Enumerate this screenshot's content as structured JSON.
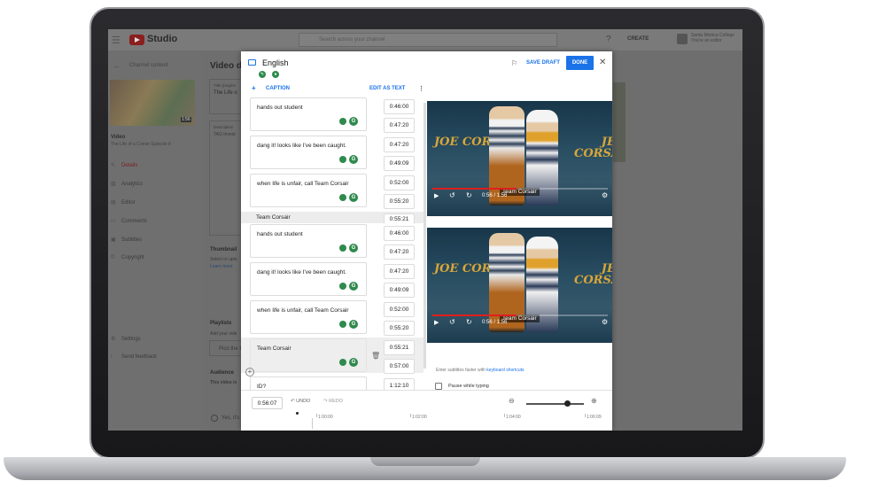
{
  "studio": {
    "brand": "Studio",
    "search_placeholder": "Search across your channel",
    "create_label": "CREATE",
    "account_name": "Santa Monica College",
    "account_sub": "You're an editor",
    "side": {
      "back_label": "Channel content",
      "video_label": "Video",
      "video_title": "The Life of a Comer Episode 8",
      "duration": "1:56",
      "nav": [
        {
          "label": "Details",
          "icon": "pencil-icon",
          "active": true
        },
        {
          "label": "Analytics",
          "icon": "chart-icon",
          "active": false
        },
        {
          "label": "Editor",
          "icon": "film-icon",
          "active": false
        },
        {
          "label": "Comments",
          "icon": "comment-icon",
          "active": false
        },
        {
          "label": "Subtitles",
          "icon": "subtitles-icon",
          "active": false
        },
        {
          "label": "Copyright",
          "icon": "copyright-icon",
          "active": false
        }
      ],
      "bottom_nav": [
        {
          "label": "Settings",
          "icon": "gear-icon"
        },
        {
          "label": "Send feedback",
          "icon": "feedback-icon"
        }
      ]
    },
    "main": {
      "heading": "Video d",
      "title_label": "Title (require",
      "title_value": "The Life o",
      "desc_label": "Description",
      "desc_value": "TAG Invest",
      "thumbnail": "Thumbnail",
      "thumb_sub": "Select or uplo",
      "learn_more": "Learn more",
      "playlists": "Playlists",
      "playlists_sub": "Add your vide",
      "playlist_value": "Pico the P",
      "audience": "Audience",
      "audience_sub": "This video is",
      "yes_label": "Yes, it's"
    }
  },
  "modal": {
    "language": "English",
    "save_draft": "SAVE DRAFT",
    "done": "DONE",
    "caption_button": "CAPTION",
    "edit_as_text": "EDIT AS TEXT",
    "captions": [
      {
        "text": "hands out student",
        "start": "0:46:00",
        "end": "0:47:20",
        "style": "box"
      },
      {
        "text": "dang it! looks like I've been caught.",
        "start": "0:47:20",
        "end": "0:49:09",
        "style": "box"
      },
      {
        "text": "when life is unfair, call Team Corsair",
        "start": "0:52:00",
        "end": "0:55:20",
        "style": "box"
      },
      {
        "text": "Team Corsair",
        "start": "0:55:21",
        "end": "",
        "style": "plain"
      },
      {
        "text": "hands out student",
        "start": "0:46:00",
        "end": "0:47:20",
        "style": "box"
      },
      {
        "text": "dang it! looks like I've been caught.",
        "start": "0:47:20",
        "end": "0:49:09",
        "style": "box"
      },
      {
        "text": "when life is unfair, call Team Corsair",
        "start": "0:52:00",
        "end": "0:55:20",
        "style": "box"
      },
      {
        "text": "Team Corsair",
        "start": "0:55:21",
        "end": "0:57:00",
        "style": "selected"
      },
      {
        "text": "ID?",
        "start": "1:12:10",
        "end": "",
        "style": "box"
      }
    ],
    "preview": {
      "left_title": "JOE CORSAIR",
      "right_title": "JEAN CORSAIR",
      "subtitle": "Team Corsair",
      "time": "0:56 / 1:56",
      "progress": 0.48,
      "hint_prefix": "Enter subtitles faster with ",
      "hint_link": "keyboard shortcuts"
    },
    "pause_label": "Pause while typing",
    "timecode": "0:56:07",
    "undo": "UNDO",
    "redo": "REDO",
    "zoom_level": 0.7,
    "ruler": [
      "1:00:00",
      "1:02:00",
      "1:04:00",
      "1:06:09"
    ]
  }
}
